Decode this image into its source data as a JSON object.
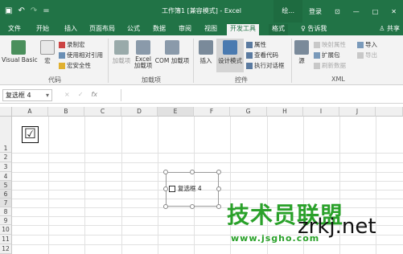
{
  "titlebar": {
    "title": "工作簿1 [兼容模式] - Excel",
    "undo": "↶",
    "redo": "↷",
    "more": "=",
    "ctx_label": "绘...",
    "login": "登录",
    "ribbon_display": "⊡",
    "minimize": "—",
    "maximize": "□",
    "close": "✕"
  },
  "tabs": [
    "文件",
    "开始",
    "插入",
    "页面布局",
    "公式",
    "数据",
    "审阅",
    "视图",
    "开发工具",
    "格式"
  ],
  "tell_me": "告诉我",
  "share": "共享",
  "ribbon": {
    "code_group": {
      "label": "代码",
      "vb": "Visual Basic",
      "macro": "宏",
      "record_macro": "录制宏",
      "relative_ref": "使用相对引用",
      "macro_security": "宏安全性"
    },
    "addins_group": {
      "label": "加载项",
      "addins": "加载项",
      "excel_addins": "Excel 加载项",
      "com_addins": "COM 加载项"
    },
    "controls_group": {
      "label": "控件",
      "insert": "插入",
      "design_mode": "设计模式",
      "properties": "属性",
      "view_code": "查看代码",
      "run_dialog": "执行对话框"
    },
    "xml_group": {
      "label": "XML",
      "source": "源",
      "map_props": "映射属性",
      "expansion_packs": "扩展包",
      "refresh_data": "刷新数据",
      "import": "导入",
      "export": "导出"
    }
  },
  "formula_bar": {
    "name_box": "复选框 4",
    "cancel": "×",
    "enter": "✓",
    "fx": "fx",
    "content": ""
  },
  "sheet": {
    "columns": [
      "A",
      "B",
      "C",
      "D",
      "E",
      "F",
      "G",
      "H",
      "I",
      "J"
    ],
    "rows": [
      "1",
      "2",
      "3",
      "4",
      "5",
      "6",
      "7",
      "8",
      "9",
      "10",
      "11",
      "12"
    ],
    "big_checkbox": "☑",
    "checkbox_label": "复选框 4"
  },
  "watermark": {
    "cn": "技术员联盟",
    "url": "www.jsgho.com",
    "site": "zrkj.net"
  },
  "colors": {
    "excel_green": "#217346",
    "watermark_green": "#2aa12a"
  }
}
